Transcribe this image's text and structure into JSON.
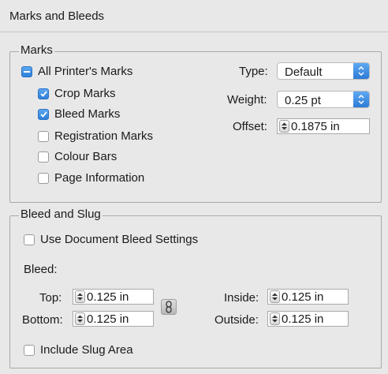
{
  "dialog": {
    "title": "Marks and Bleeds"
  },
  "marks": {
    "legend": "Marks",
    "all_printers_marks": {
      "label": "All Printer's Marks",
      "state": "mixed"
    },
    "options": [
      {
        "label": "Crop Marks",
        "checked": true
      },
      {
        "label": "Bleed Marks",
        "checked": true
      },
      {
        "label": "Registration Marks",
        "checked": false
      },
      {
        "label": "Colour Bars",
        "checked": false
      },
      {
        "label": "Page Information",
        "checked": false
      }
    ],
    "type": {
      "label": "Type:",
      "value": "Default"
    },
    "weight": {
      "label": "Weight:",
      "value": "0.25 pt"
    },
    "offset": {
      "label": "Offset:",
      "value": "0.1875 in"
    }
  },
  "bleed_slug": {
    "legend": "Bleed and Slug",
    "use_document_bleed": {
      "label": "Use Document Bleed Settings",
      "checked": false
    },
    "bleed_heading": "Bleed:",
    "top": {
      "label": "Top:",
      "value": "0.125 in"
    },
    "bottom": {
      "label": "Bottom:",
      "value": "0.125 in"
    },
    "inside": {
      "label": "Inside:",
      "value": "0.125 in"
    },
    "outside": {
      "label": "Outside:",
      "value": "0.125 in"
    },
    "include_slug": {
      "label": "Include Slug Area",
      "checked": false
    }
  },
  "icons": {
    "checkmark": "checkmark-icon",
    "mixed": "minus-icon",
    "select_arrows": "updown-chevron-icon",
    "stepper": "stepper-arrows-icon",
    "link": "chain-link-icon"
  },
  "colors": {
    "accent": "#3a8ee6",
    "background": "#e8e8e8"
  }
}
